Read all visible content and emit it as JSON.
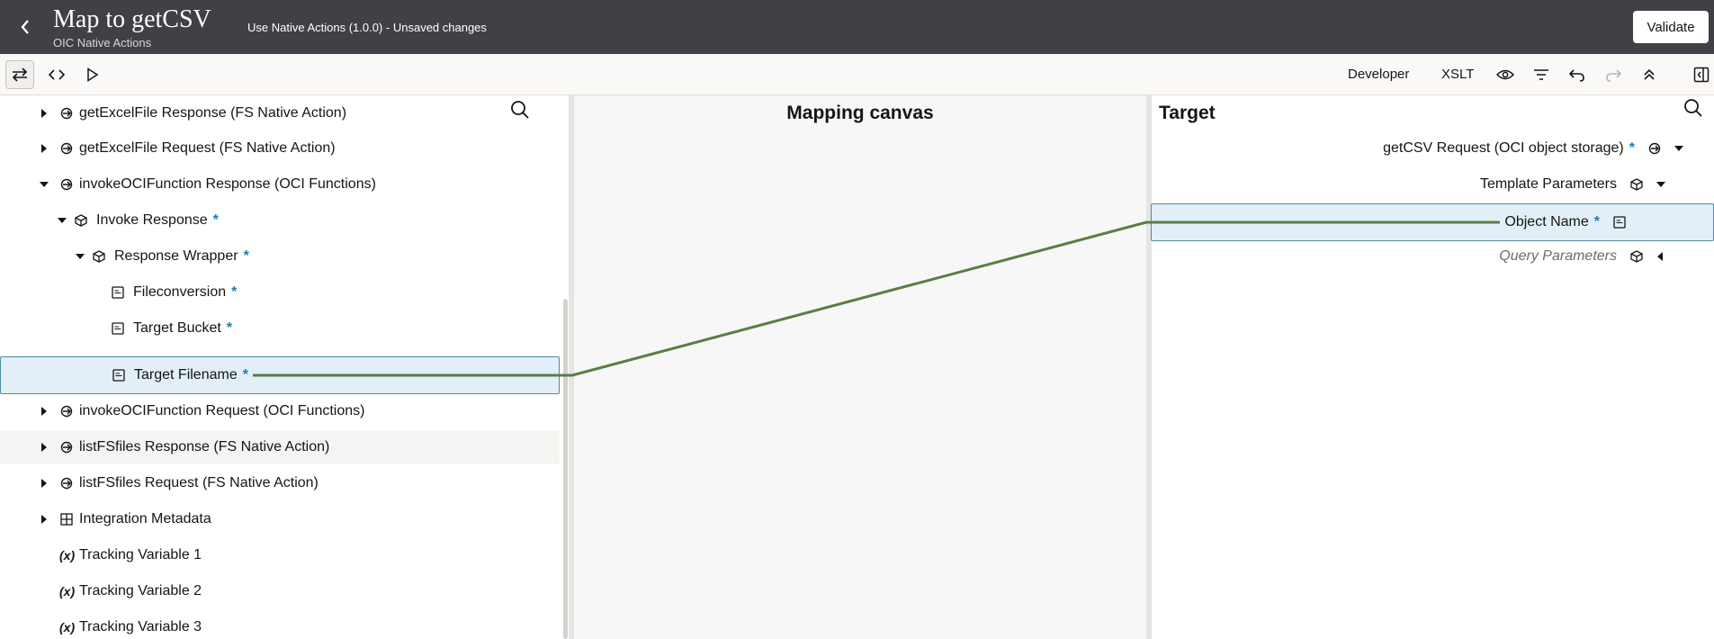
{
  "header": {
    "title": "Map to getCSV",
    "subtitle": "OIC Native Actions",
    "status": "Use Native Actions (1.0.0) - Unsaved changes",
    "validate_label": "Validate"
  },
  "toolbar": {
    "developer_label": "Developer",
    "xslt_label": "XSLT"
  },
  "source_tree": [
    {
      "label": "getExcelFile Response (FS Native Action)",
      "required": false,
      "icon": "message-icon",
      "expanded": false
    },
    {
      "label": "getExcelFile Request (FS Native Action)",
      "required": false,
      "icon": "message-icon",
      "expanded": false
    },
    {
      "label": "invokeOCIFunction Response (OCI Functions)",
      "required": false,
      "icon": "message-icon",
      "expanded": true
    },
    {
      "label": "Invoke Response",
      "required": true,
      "icon": "cube-icon",
      "expanded": true
    },
    {
      "label": "Response Wrapper",
      "required": true,
      "icon": "cube-icon",
      "expanded": true
    },
    {
      "label": "Fileconversion",
      "required": true,
      "icon": "string-field-icon"
    },
    {
      "label": "Target Bucket",
      "required": true,
      "icon": "string-field-icon"
    },
    {
      "label": "Target Filename",
      "required": true,
      "icon": "string-field-icon",
      "selected": true
    },
    {
      "label": "invokeOCIFunction Request (OCI Functions)",
      "required": false,
      "icon": "message-icon",
      "expanded": false
    },
    {
      "label": "listFSfiles Response (FS Native Action)",
      "required": false,
      "icon": "message-icon",
      "expanded": false
    },
    {
      "label": "listFSfiles Request (FS Native Action)",
      "required": false,
      "icon": "message-icon",
      "expanded": false
    },
    {
      "label": "Integration Metadata",
      "required": false,
      "icon": "grid-icon",
      "expanded": false
    },
    {
      "label": "Tracking Variable 1",
      "variable_marker": "(x)"
    },
    {
      "label": "Tracking Variable 2",
      "variable_marker": "(x)"
    },
    {
      "label": "Tracking Variable 3",
      "variable_marker": "(x)"
    }
  ],
  "required_marker": "*",
  "canvas": {
    "title": "Mapping canvas"
  },
  "target": {
    "title": "Target",
    "rows": [
      {
        "label": "getCSV Request (OCI object storage)",
        "required": true,
        "icon": "message-icon"
      },
      {
        "label": "Template Parameters",
        "required": false,
        "icon": "cube-icon"
      },
      {
        "label": "Object Name",
        "required": true,
        "icon": "string-field-icon",
        "selected": true
      },
      {
        "label": "Query Parameters",
        "required": false,
        "icon": "cube-icon",
        "italic": true
      }
    ]
  },
  "colors": {
    "header_bg": "#3f4146",
    "mapping_line": "#5a7d47",
    "selection_bg": "#e2eff6",
    "required": "#227bb1"
  }
}
